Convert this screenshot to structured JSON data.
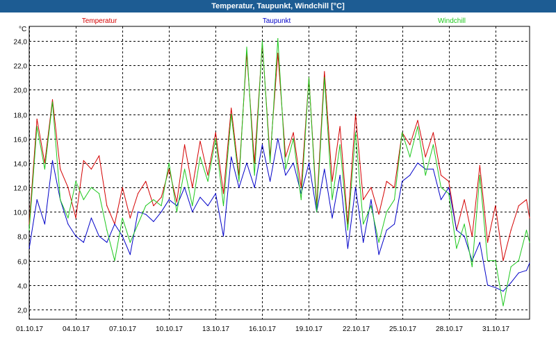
{
  "window": {
    "title": "Temperatur, Taupunkt, Windchill [°C]"
  },
  "chart_data": {
    "type": "line",
    "title": "Temperatur, Taupunkt, Windchill [°C]",
    "ylabel": "°C",
    "xlabel": "",
    "ylim": [
      1.2,
      25.2
    ],
    "y_ticks": [
      2.0,
      4.0,
      6.0,
      8.0,
      10.0,
      12.0,
      14.0,
      16.0,
      18.0,
      20.0,
      22.0,
      24.0
    ],
    "y_tick_labels": [
      "2,0",
      "4,0",
      "6,0",
      "8,0",
      "10,0",
      "12,0",
      "14,0",
      "16,0",
      "18,0",
      "20,0",
      "22,0",
      "24,0"
    ],
    "x_ticks": [
      0,
      3,
      6,
      9,
      12,
      15,
      18,
      21,
      24,
      27,
      30
    ],
    "x_tick_labels": [
      "01.10.17",
      "04.10.17",
      "07.10.17",
      "10.10.17",
      "13.10.17",
      "16.10.17",
      "19.10.17",
      "22.10.17",
      "25.10.17",
      "28.10.17",
      "31.10.17"
    ],
    "xlim": [
      0,
      32.2
    ],
    "grid": true,
    "legend_position": "top",
    "x": [
      0,
      0.5,
      1,
      1.5,
      2,
      2.5,
      3,
      3.5,
      4,
      4.5,
      5,
      5.5,
      6,
      6.5,
      7,
      7.5,
      8,
      8.5,
      9,
      9.5,
      10,
      10.5,
      11,
      11.5,
      12,
      12.5,
      13,
      13.5,
      14,
      14.5,
      15,
      15.5,
      16,
      16.5,
      17,
      17.5,
      18,
      18.5,
      19,
      19.5,
      20,
      20.5,
      21,
      21.5,
      22,
      22.5,
      23,
      23.5,
      24,
      24.5,
      25,
      25.5,
      26,
      26.5,
      27,
      27.5,
      28,
      28.5,
      29,
      29.5,
      30,
      30.5,
      31,
      31.5,
      32,
      32.2
    ],
    "series": [
      {
        "name": "Temperatur",
        "color": "#d40000",
        "values": [
          9.0,
          17.6,
          14.0,
          19.2,
          13.5,
          12.0,
          9.5,
          14.2,
          13.5,
          14.6,
          10.5,
          9.0,
          12.0,
          9.5,
          11.5,
          12.5,
          10.5,
          11.2,
          13.5,
          10.8,
          15.5,
          12.0,
          15.8,
          13.0,
          16.5,
          11.5,
          18.5,
          13.0,
          23.0,
          14.0,
          23.8,
          14.5,
          23.0,
          14.5,
          16.5,
          12.0,
          21.0,
          10.5,
          21.5,
          12.5,
          17.0,
          9.0,
          18.0,
          11.0,
          12.0,
          9.8,
          12.5,
          12.0,
          16.5,
          15.5,
          17.5,
          14.5,
          16.5,
          13.0,
          12.5,
          8.5,
          11.0,
          8.0,
          13.8,
          7.5,
          10.5,
          6.0,
          8.5,
          10.5,
          11.0,
          9.5
        ]
      },
      {
        "name": "Taupunkt",
        "color": "#0000c8",
        "values": [
          7.0,
          11.0,
          9.0,
          14.2,
          11.0,
          9.0,
          8.0,
          7.5,
          9.5,
          8.0,
          7.5,
          9.0,
          8.0,
          6.5,
          10.0,
          9.8,
          9.2,
          10.0,
          11.0,
          10.5,
          12.0,
          10.0,
          11.2,
          10.5,
          11.5,
          8.0,
          14.5,
          12.0,
          14.0,
          12.0,
          15.5,
          12.5,
          16.0,
          13.0,
          14.0,
          11.5,
          14.0,
          10.0,
          13.5,
          9.5,
          13.0,
          7.0,
          12.0,
          7.5,
          11.0,
          6.5,
          8.5,
          9.0,
          12.5,
          13.0,
          14.0,
          13.5,
          13.5,
          11.0,
          12.0,
          8.5,
          8.0,
          6.0,
          7.5,
          4.0,
          3.8,
          3.5,
          4.2,
          5.0,
          5.2,
          5.8
        ]
      },
      {
        "name": "Windchill",
        "color": "#1ec81e",
        "values": [
          8.5,
          17.0,
          13.5,
          19.0,
          11.0,
          9.5,
          12.5,
          11.0,
          12.0,
          11.5,
          8.5,
          6.0,
          9.5,
          7.5,
          9.0,
          10.5,
          11.0,
          10.5,
          14.0,
          10.0,
          13.5,
          10.5,
          14.5,
          12.5,
          16.0,
          10.5,
          18.0,
          12.5,
          23.5,
          13.0,
          24.0,
          14.0,
          24.2,
          13.5,
          16.0,
          11.0,
          21.0,
          10.0,
          21.0,
          11.0,
          15.5,
          8.5,
          16.5,
          9.0,
          10.5,
          7.5,
          10.0,
          11.0,
          16.5,
          14.5,
          17.0,
          13.0,
          15.5,
          12.0,
          11.5,
          7.0,
          9.0,
          5.5,
          13.0,
          6.0,
          6.0,
          2.3,
          5.5,
          6.0,
          8.5,
          7.5
        ]
      }
    ]
  }
}
